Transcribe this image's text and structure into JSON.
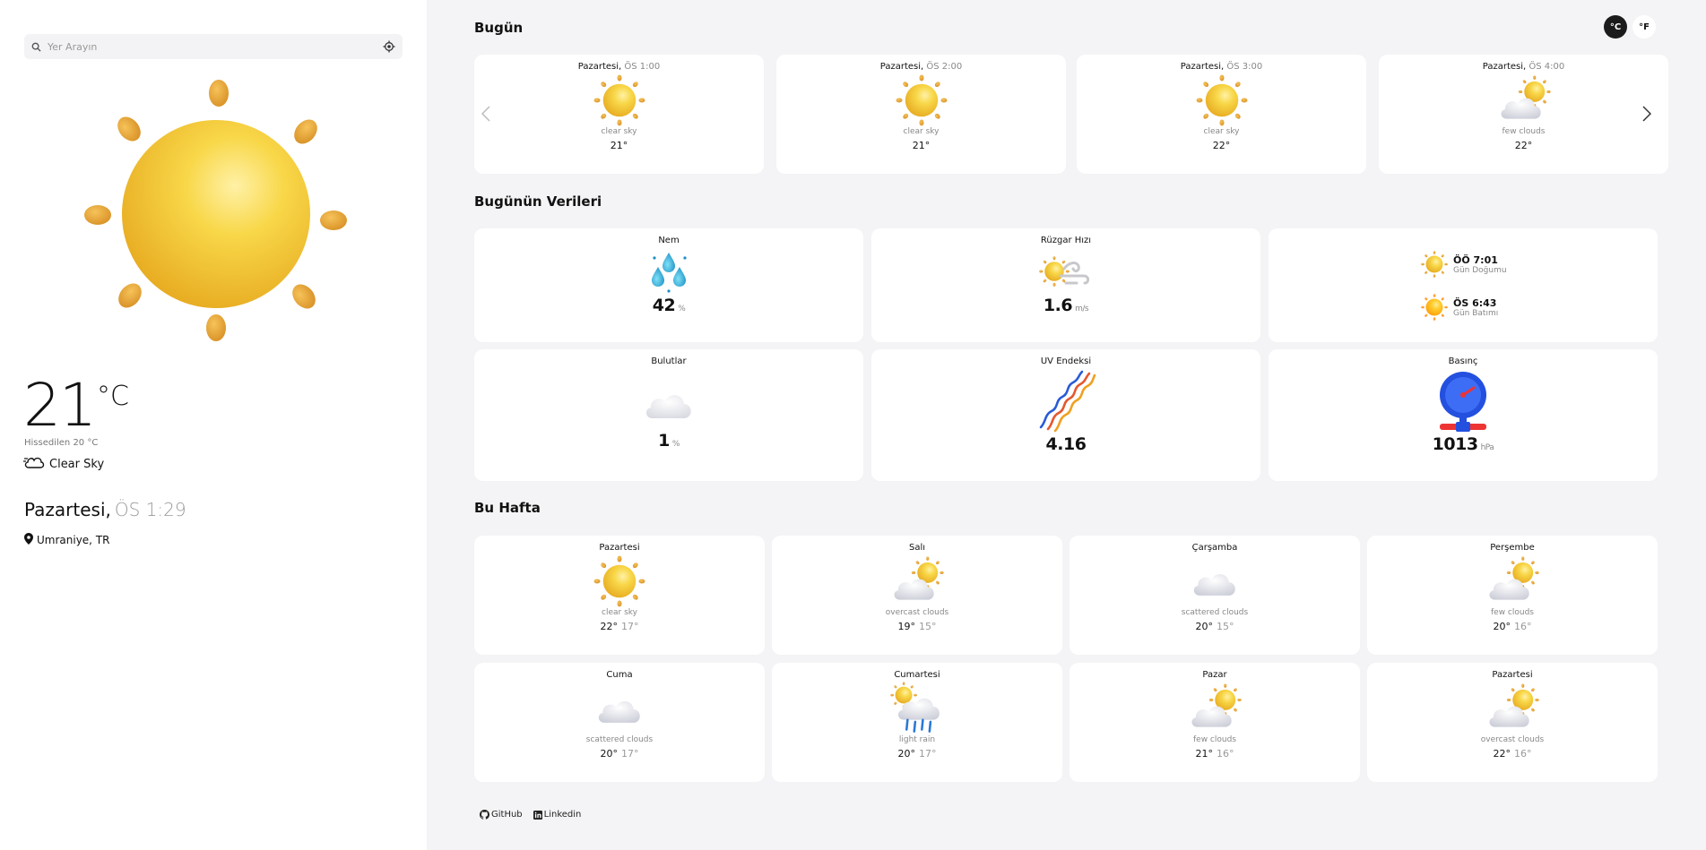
{
  "search": {
    "placeholder": "Yer Arayın"
  },
  "current": {
    "temp": "21",
    "unit": "°C",
    "feels_like": "Hissedilen 20 °C",
    "condition": "Clear Sky",
    "day": "Pazartesi,",
    "time": "ÖS 1:29",
    "location": "Umraniye, TR"
  },
  "units": {
    "celsius": "°C",
    "fahrenheit": "°F"
  },
  "today": {
    "heading": "Bugün",
    "items": [
      {
        "day": "Pazartesi,",
        "time": "ÖS 1:00",
        "desc": "clear sky",
        "temp": "21°",
        "icon": "sun-icon"
      },
      {
        "day": "Pazartesi,",
        "time": "ÖS 2:00",
        "desc": "clear sky",
        "temp": "21°",
        "icon": "sun-icon"
      },
      {
        "day": "Pazartesi,",
        "time": "ÖS 3:00",
        "desc": "clear sky",
        "temp": "22°",
        "icon": "sun-icon"
      },
      {
        "day": "Pazartesi,",
        "time": "ÖS 4:00",
        "desc": "few clouds",
        "temp": "22°",
        "icon": "sun-cloud-icon"
      }
    ]
  },
  "highlights": {
    "heading": "Bugünün Verileri",
    "humidity": {
      "label": "Nem",
      "value": "42",
      "unit": "%"
    },
    "wind": {
      "label": "Rüzgar Hızı",
      "value": "1.6",
      "unit": "m/s"
    },
    "sun": {
      "sunrise_time": "ÖÖ 7:01",
      "sunrise_label": "Gün Doğumu",
      "sunset_time": "ÖS 6:43",
      "sunset_label": "Gün Batımı"
    },
    "clouds": {
      "label": "Bulutlar",
      "value": "1",
      "unit": "%"
    },
    "uv": {
      "label": "UV Endeksi",
      "value": "4.16"
    },
    "pressure": {
      "label": "Basınç",
      "value": "1013",
      "unit": "hPa"
    }
  },
  "week": {
    "heading": "Bu Hafta",
    "items": [
      {
        "day": "Pazartesi",
        "desc": "clear sky",
        "hi": "22°",
        "lo": "17°",
        "icon": "sun-icon"
      },
      {
        "day": "Salı",
        "desc": "overcast clouds",
        "hi": "19°",
        "lo": "15°",
        "icon": "sun-cloud-icon"
      },
      {
        "day": "Çarşamba",
        "desc": "scattered clouds",
        "hi": "20°",
        "lo": "15°",
        "icon": "cloud-icon"
      },
      {
        "day": "Perşembe",
        "desc": "few clouds",
        "hi": "20°",
        "lo": "16°",
        "icon": "sun-cloud-icon"
      },
      {
        "day": "Cuma",
        "desc": "scattered clouds",
        "hi": "20°",
        "lo": "17°",
        "icon": "cloud-icon"
      },
      {
        "day": "Cumartesi",
        "desc": "light rain",
        "hi": "20°",
        "lo": "17°",
        "icon": "rain-icon"
      },
      {
        "day": "Pazar",
        "desc": "few clouds",
        "hi": "21°",
        "lo": "16°",
        "icon": "sun-cloud-icon"
      },
      {
        "day": "Pazartesi",
        "desc": "overcast clouds",
        "hi": "22°",
        "lo": "16°",
        "icon": "sun-cloud-icon"
      }
    ]
  },
  "footer": {
    "github": "GitHub",
    "linkedin": "Linkedin"
  }
}
